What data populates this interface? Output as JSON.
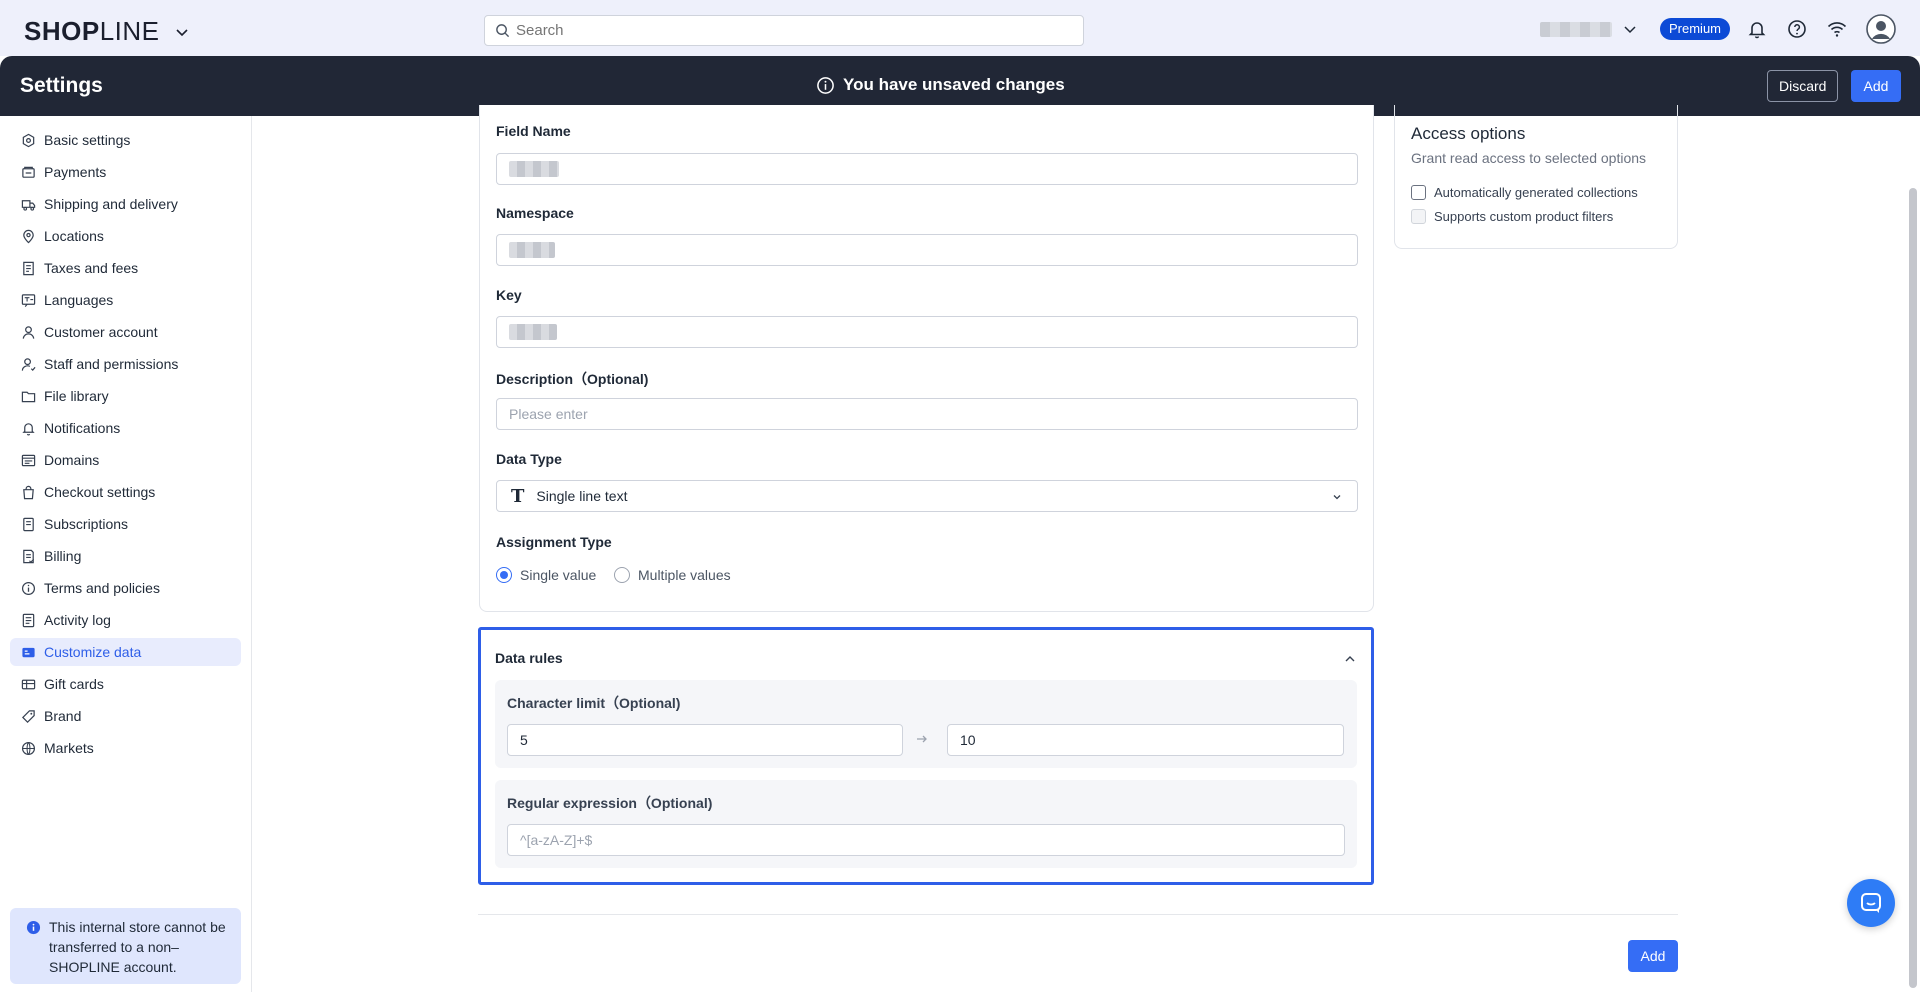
{
  "topbar": {
    "logo_bold": "SHOP",
    "logo_light": "LINE",
    "search_placeholder": "Search",
    "premium_badge": "Premium"
  },
  "settings_bar": {
    "title": "Settings",
    "unsaved_message": "You have unsaved changes",
    "discard_label": "Discard",
    "add_label": "Add"
  },
  "sidebar": {
    "items": [
      {
        "label": "Basic settings",
        "icon": "store-icon"
      },
      {
        "label": "Payments",
        "icon": "payment-icon"
      },
      {
        "label": "Shipping and delivery",
        "icon": "truck-icon"
      },
      {
        "label": "Locations",
        "icon": "location-pin-icon"
      },
      {
        "label": "Taxes and fees",
        "icon": "receipt-icon"
      },
      {
        "label": "Languages",
        "icon": "translate-icon"
      },
      {
        "label": "Customer account",
        "icon": "user-icon"
      },
      {
        "label": "Staff and permissions",
        "icon": "staff-icon"
      },
      {
        "label": "File library",
        "icon": "folder-icon"
      },
      {
        "label": "Notifications",
        "icon": "bell-icon"
      },
      {
        "label": "Domains",
        "icon": "domain-icon"
      },
      {
        "label": "Checkout settings",
        "icon": "bag-icon"
      },
      {
        "label": "Subscriptions",
        "icon": "subscription-icon"
      },
      {
        "label": "Billing",
        "icon": "billing-icon"
      },
      {
        "label": "Terms and policies",
        "icon": "info-circle-icon"
      },
      {
        "label": "Activity log",
        "icon": "log-icon"
      },
      {
        "label": "Customize data",
        "icon": "data-icon"
      },
      {
        "label": "Gift cards",
        "icon": "gift-card-icon"
      },
      {
        "label": "Brand",
        "icon": "brand-icon"
      },
      {
        "label": "Markets",
        "icon": "globe-icon"
      }
    ],
    "active_item": "Customize data",
    "notice": "This internal store cannot be transferred to a non–SHOPLINE account."
  },
  "form": {
    "field_name_label": "Field Name",
    "namespace_label": "Namespace",
    "key_label": "Key",
    "description_label": "Description（Optional)",
    "description_placeholder": "Please enter",
    "data_type_label": "Data Type",
    "data_type_value": "Single line text",
    "assignment_type_label": "Assignment Type",
    "assignment_options": [
      "Single value",
      "Multiple values"
    ],
    "assignment_selected": "Single value"
  },
  "data_rules": {
    "title": "Data rules",
    "char_limit_label": "Character limit（Optional)",
    "char_limit_min": "5",
    "char_limit_max": "10",
    "regex_label": "Regular expression（Optional)",
    "regex_placeholder": "^[a-zA-Z]+$"
  },
  "access_options": {
    "title": "Access options",
    "subtitle": "Grant read access to selected options",
    "options": [
      {
        "label": "Automatically generated collections",
        "checked": false,
        "disabled": false
      },
      {
        "label": "Supports custom product filters",
        "checked": false,
        "disabled": true
      }
    ]
  },
  "footer": {
    "add_label": "Add"
  },
  "colors": {
    "accent": "#356df5",
    "header_bg": "#212736",
    "active_nav_bg": "#e8ecfd",
    "rules_border": "#2e5ee8"
  }
}
